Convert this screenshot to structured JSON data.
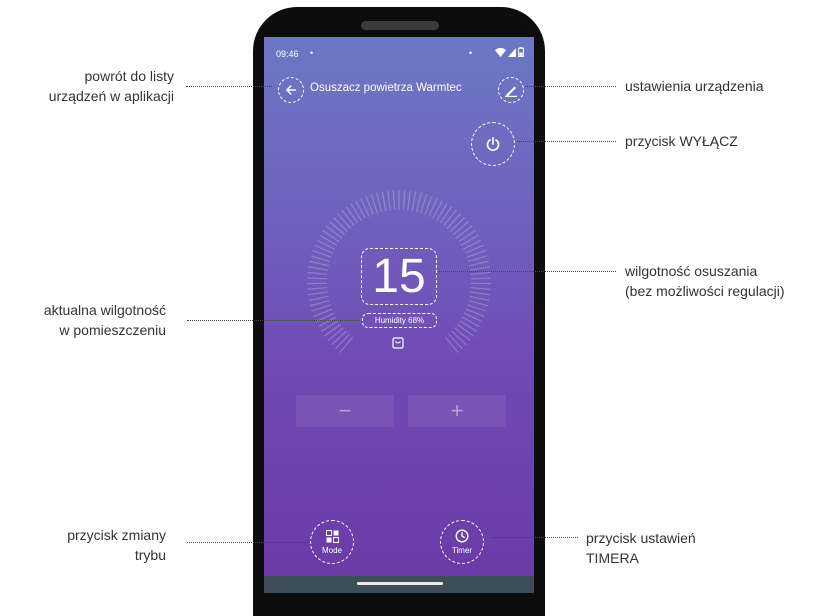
{
  "status_bar": {
    "time": "09:46",
    "dot_left": "•",
    "dot_right": "•",
    "icons": [
      "wifi-icon",
      "signal-icon",
      "battery-icon"
    ]
  },
  "header": {
    "title": "Osuszacz powietrza Warmtec",
    "back_icon": "arrow-left-icon",
    "edit_icon": "pencil-icon"
  },
  "power": {
    "icon": "power-icon"
  },
  "dial": {
    "value": "15",
    "humidity_label": "Humidity 68%",
    "tank_icon": "water-tank-icon"
  },
  "controls": {
    "minus_label": "−",
    "plus_label": "+"
  },
  "bottom": {
    "mode_label": "Mode",
    "mode_icon": "mode-grid-icon",
    "timer_label": "Timer",
    "timer_icon": "clock-icon"
  },
  "callouts": {
    "back": [
      "powrót do listy",
      "urządzeń w aplikacji"
    ],
    "settings": [
      "ustawienia urządzenia"
    ],
    "power": [
      "przycisk WYŁĄCZ"
    ],
    "dehumid": [
      "wilgotność osuszania",
      "(bez możliwości regulacji)"
    ],
    "current": [
      "aktualna wilgotność",
      "w pomieszczeniu"
    ],
    "mode": [
      "przycisk zmiany",
      "trybu"
    ],
    "timer": [
      "przycisk ustawień",
      "TIMERA"
    ]
  },
  "colors": {
    "screen_top": "#6c78c5",
    "screen_bottom": "#6a3aa6",
    "nav_bar": "#3d4e58",
    "phone_body": "#0d0d0d"
  }
}
